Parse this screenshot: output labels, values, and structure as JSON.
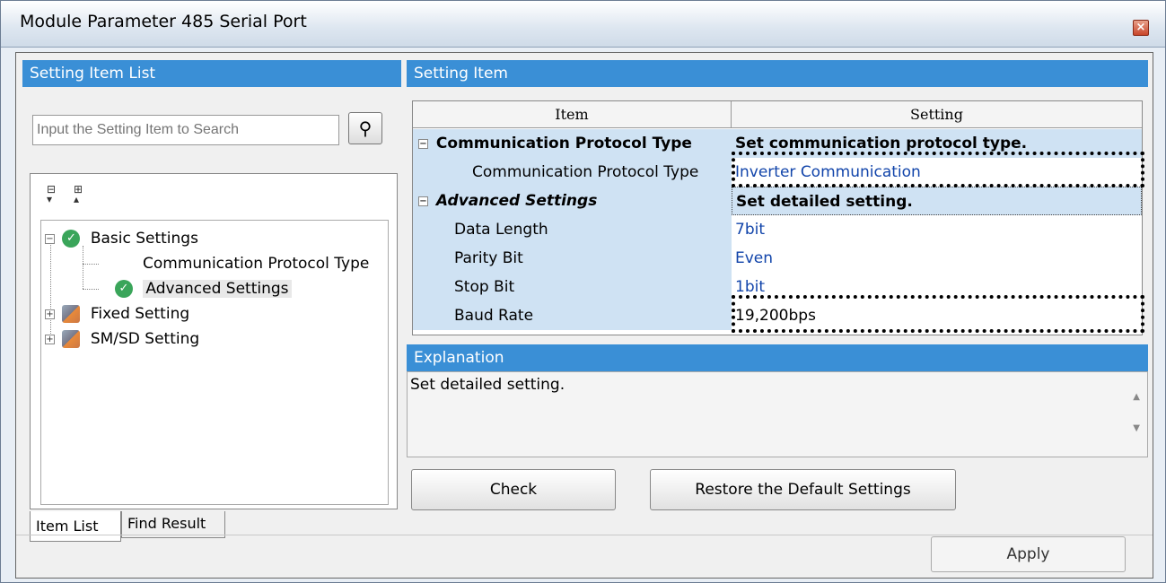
{
  "window": {
    "title": "Module Parameter 485 Serial Port",
    "close_glyph": "×"
  },
  "left": {
    "header": "Setting Item List",
    "search_placeholder": "Input the Setting Item to Search",
    "tree": {
      "basic": "Basic Settings",
      "protocol": "Communication Protocol Type",
      "advanced": "Advanced Settings",
      "fixed": "Fixed Setting",
      "smsd": "SM/SD Setting"
    },
    "tabs": {
      "item_list": "Item List",
      "find_result": "Find Result"
    }
  },
  "right": {
    "header": "Setting Item",
    "grid": {
      "col_item": "Item",
      "col_setting": "Setting",
      "rows": [
        {
          "item": "Communication Protocol Type",
          "setting": "Set communication protocol type."
        },
        {
          "item": "Communication Protocol Type",
          "setting": "Inverter Communication"
        },
        {
          "item": "Advanced Settings",
          "setting": "Set detailed setting."
        },
        {
          "item": "Data Length",
          "setting": "7bit"
        },
        {
          "item": "Parity Bit",
          "setting": "Even"
        },
        {
          "item": "Stop Bit",
          "setting": "1bit"
        },
        {
          "item": "Baud Rate",
          "setting": "19,200bps"
        }
      ]
    },
    "explanation_header": "Explanation",
    "explanation_text": "Set detailed setting.",
    "buttons": {
      "check": "Check",
      "restore": "Restore the Default Settings"
    }
  },
  "footer": {
    "apply": "Apply"
  }
}
